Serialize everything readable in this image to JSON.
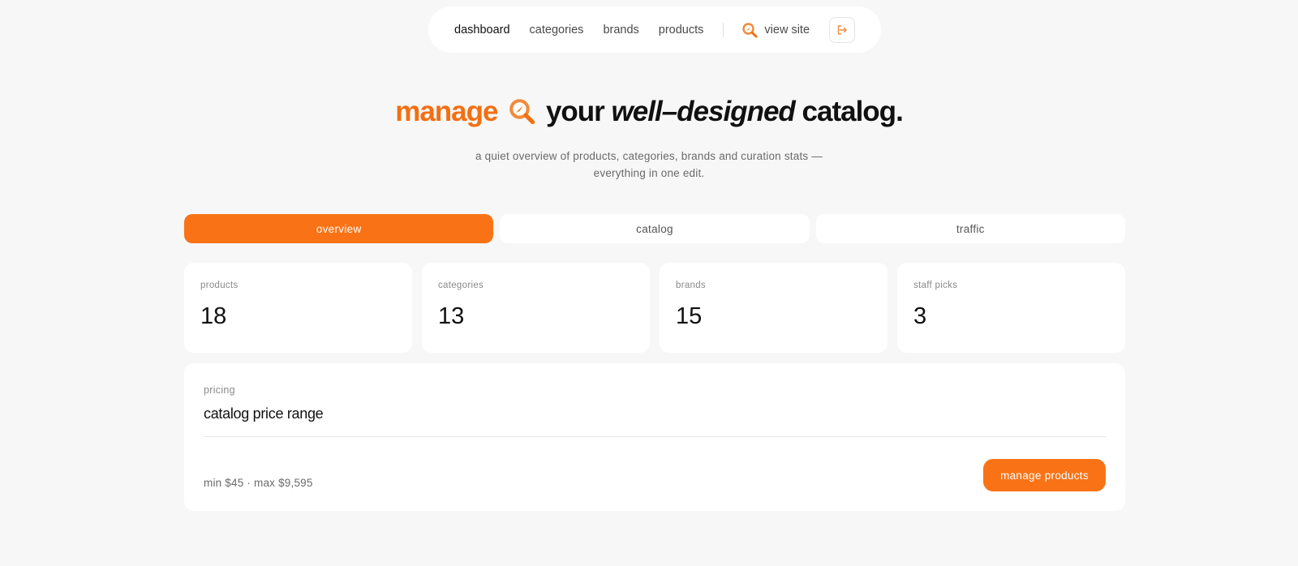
{
  "nav": {
    "items": [
      {
        "label": "dashboard",
        "active": true
      },
      {
        "label": "categories",
        "active": false
      },
      {
        "label": "brands",
        "active": false
      },
      {
        "label": "products",
        "active": false
      }
    ],
    "view_site": {
      "label": "view site",
      "icon": "magnifier-logo-icon"
    },
    "logout": {
      "icon": "logout-icon"
    }
  },
  "hero": {
    "accent": "manage",
    "part1": "your",
    "italic": "well–designed",
    "part2": "catalog.",
    "subtitle": "a quiet overview of products, categories, brands and curation stats — everything in one edit."
  },
  "tabs": [
    {
      "label": "overview",
      "active": true
    },
    {
      "label": "catalog",
      "active": false
    },
    {
      "label": "traffic",
      "active": false
    }
  ],
  "stats": [
    {
      "label": "products",
      "value": "18"
    },
    {
      "label": "categories",
      "value": "13"
    },
    {
      "label": "brands",
      "value": "15"
    },
    {
      "label": "staff picks",
      "value": "3"
    }
  ],
  "pricing": {
    "label": "pricing",
    "title": "catalog price range",
    "range": "min $45 · max $9,595",
    "button": "manage products"
  },
  "colors": {
    "accent": "#f97316",
    "background": "#f7f7f7",
    "card": "#ffffff"
  }
}
